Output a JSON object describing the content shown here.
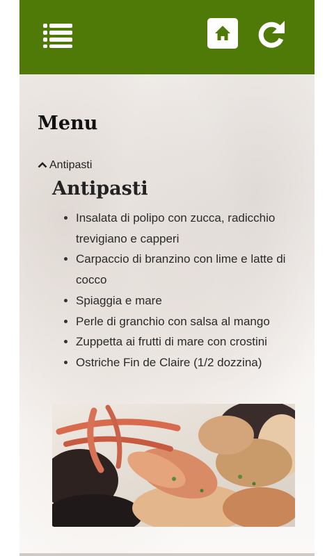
{
  "header": {
    "menu_icon": "list-menu-icon",
    "home_icon": "home-icon",
    "refresh_icon": "refresh-icon",
    "bar_color": "#4f7a07"
  },
  "main": {
    "title": "Menu",
    "section": {
      "toggle_label": "Antipasti",
      "toggle_icon": "chevron-up-icon",
      "heading": "Antipasti",
      "items": [
        "Insalata di polipo con zucca, radicchio trevigiano e capperi",
        "Carpaccio di branzino con lime e latte di cocco",
        "Spiaggia e mare",
        "Perle di granchio con salsa al mango",
        "Zuppetta ai frutti di mare con crostini",
        "Ostriche Fin de Claire (1/2 dozzina)"
      ]
    }
  }
}
